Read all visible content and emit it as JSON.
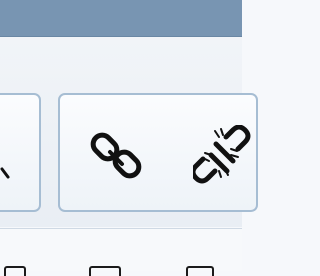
{
  "window": {
    "titlebar_color": "#7895b2"
  },
  "ribbon": {
    "groups": [
      {
        "name": "left-group",
        "icons": [
          "partial-tool-icon"
        ]
      },
      {
        "name": "link-group",
        "icons": [
          "link-icon",
          "unlink-icon"
        ]
      }
    ]
  },
  "colors": {
    "border": "#a6bdd3",
    "icon": "#111111"
  }
}
